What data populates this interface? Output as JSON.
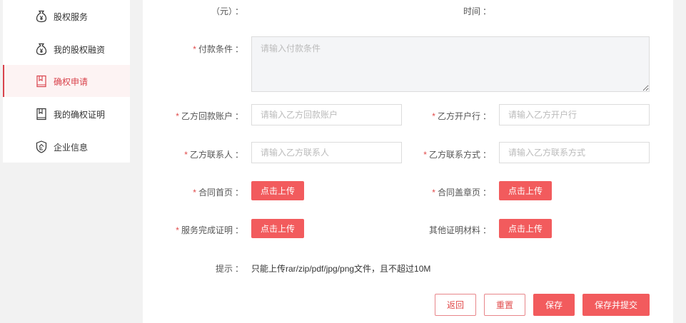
{
  "sidebar": {
    "items": [
      {
        "label": "股权服务",
        "icon": "money-bag-icon",
        "active": false
      },
      {
        "label": "我的股权融资",
        "icon": "money-bag-icon",
        "active": false
      },
      {
        "label": "确权申请",
        "icon": "bookmark-icon",
        "active": true
      },
      {
        "label": "我的确权证明",
        "icon": "bookmark-icon",
        "active": false
      },
      {
        "label": "企业信息",
        "icon": "enterprise-shield-icon",
        "active": false
      }
    ],
    "accent_color": "#d9434c"
  },
  "form": {
    "top_partial": {
      "left_label": "（元）",
      "right_label": "时间"
    },
    "payment_terms": {
      "label": "付款条件",
      "placeholder": "请输入付款条件",
      "value": ""
    },
    "payee_account": {
      "label": "乙方回款账户",
      "placeholder": "请输入乙方回款账户",
      "value": ""
    },
    "opening_bank": {
      "label": "乙方开户行",
      "placeholder": "请输入乙方开户行",
      "value": ""
    },
    "contact_person": {
      "label": "乙方联系人",
      "placeholder": "请输入乙方联系人",
      "value": ""
    },
    "contact_method": {
      "label": "乙方联系方式",
      "placeholder": "请输入乙方联系方式",
      "value": ""
    },
    "contract_first_page": {
      "label": "合同首页",
      "button": "点击上传"
    },
    "contract_seal_page": {
      "label": "合同盖章页",
      "button": "点击上传"
    },
    "service_completion_proof": {
      "label": "服务完成证明",
      "button": "点击上传"
    },
    "other_proof_materials": {
      "label": "其他证明材料",
      "button": "点击上传"
    },
    "hint": {
      "label": "提示",
      "text": "只能上传rar/zip/pdf/jpg/png文件，且不超过10M"
    },
    "required_mark": "*",
    "colon": "："
  },
  "actions": {
    "back": "返回",
    "reset": "重置",
    "save": "保存",
    "save_submit": "保存并提交"
  },
  "colors": {
    "primary": "#f25b5d",
    "required": "#e04a4a",
    "page_background": "#f2f2f2"
  }
}
